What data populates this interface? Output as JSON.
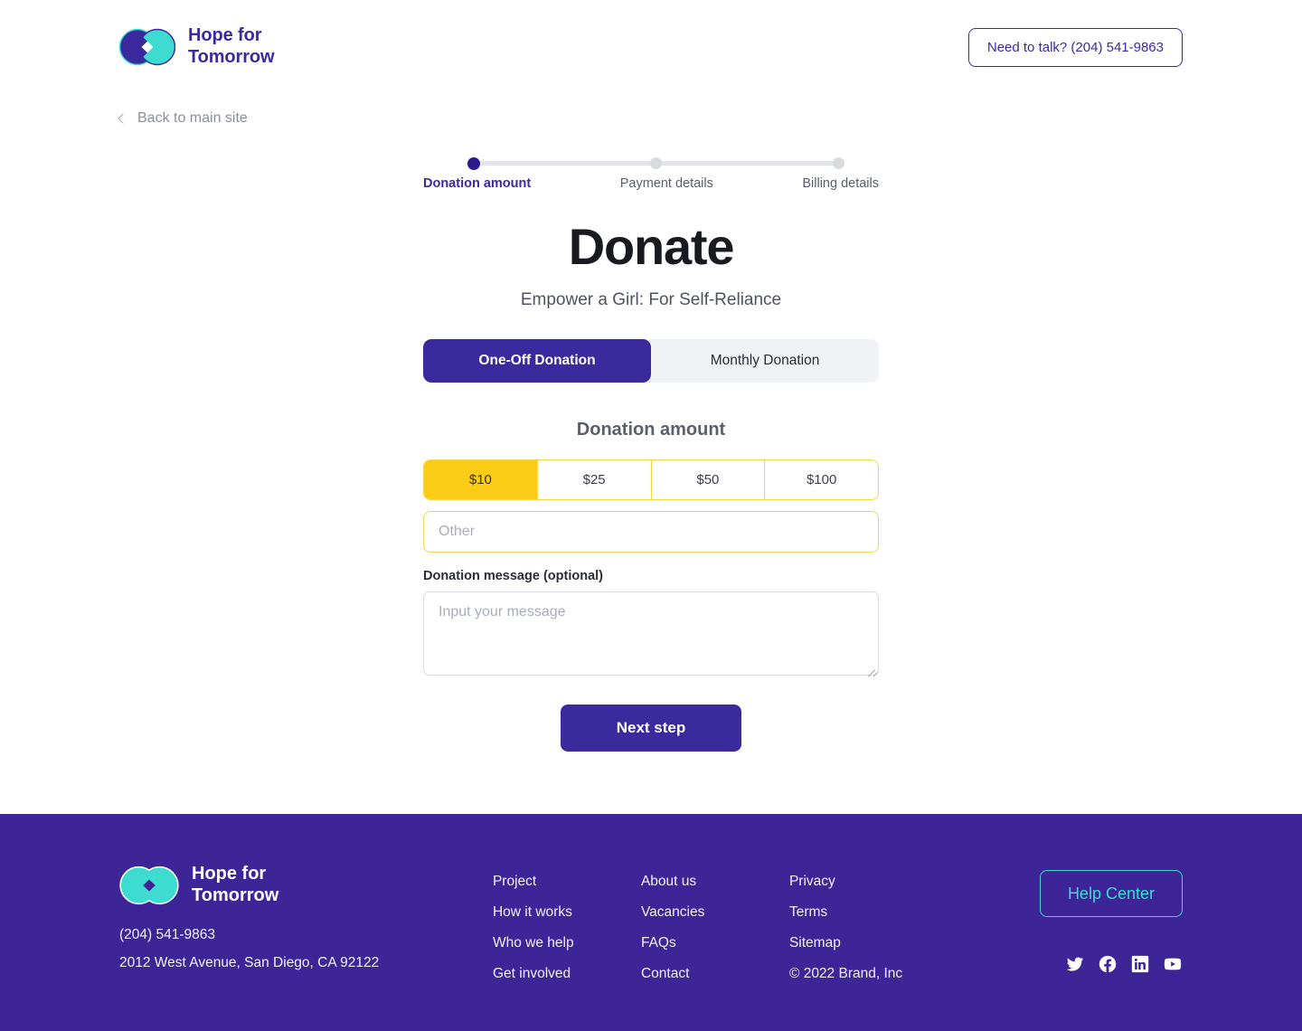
{
  "header": {
    "brand_name": "Hope for\nTomorrow",
    "logo_icon": "infinity-logo-icon",
    "contact_label": "Need to talk? (204) 541-9863"
  },
  "back_link": {
    "label": "Back to main site",
    "icon": "chevron-left-icon"
  },
  "stepper": {
    "steps": [
      {
        "label": "Donation amount",
        "state": "active"
      },
      {
        "label": "Payment details",
        "state": "upcoming"
      },
      {
        "label": "Billing details",
        "state": "upcoming"
      }
    ]
  },
  "main": {
    "title": "Donate",
    "subtitle": "Empower a Girl: For Self-Reliance",
    "tabs": [
      {
        "label": "One-Off Donation",
        "selected": true
      },
      {
        "label": "Monthly Donation",
        "selected": false
      }
    ],
    "amount_section_title": "Donation amount",
    "amounts": [
      {
        "label": "$10",
        "selected": true
      },
      {
        "label": "$25",
        "selected": false
      },
      {
        "label": "$50",
        "selected": false
      },
      {
        "label": "$100",
        "selected": false
      }
    ],
    "other_amount": {
      "value": "",
      "placeholder": "Other"
    },
    "message_label": "Donation message (optional)",
    "message": {
      "value": "",
      "placeholder": "Input your message"
    },
    "next_button": "Next step"
  },
  "footer": {
    "brand_name": "Hope for\nTomorrow",
    "logo_icon": "infinity-logo-icon",
    "phone": "(204) 541-9863",
    "address": "2012 West Avenue, San Diego, CA 92122",
    "columns": [
      {
        "links": [
          "Project",
          "How it works",
          "Who we help",
          "Get involved"
        ]
      },
      {
        "links": [
          "About us",
          "Vacancies",
          "FAQs",
          "Contact"
        ]
      },
      {
        "links": [
          "Privacy",
          "Terms",
          "Sitemap"
        ],
        "copyright": "© 2022 Brand, Inc"
      }
    ],
    "help_button": "Help Center",
    "socials": [
      "twitter-icon",
      "facebook-icon",
      "linkedin-icon",
      "youtube-icon"
    ]
  },
  "colors": {
    "brand_purple": "#3b2a9e",
    "footer_purple": "#3d2598",
    "accent_yellow": "#fbcd17",
    "accent_yellow_border": "#f6d34a",
    "teal": "#3ddbd0",
    "active_dot": "#2b1a8d",
    "inactive_dot": "#d9dae0",
    "logo_dark": "#3b2a9e",
    "logo_teal": "#3ddbd0"
  }
}
